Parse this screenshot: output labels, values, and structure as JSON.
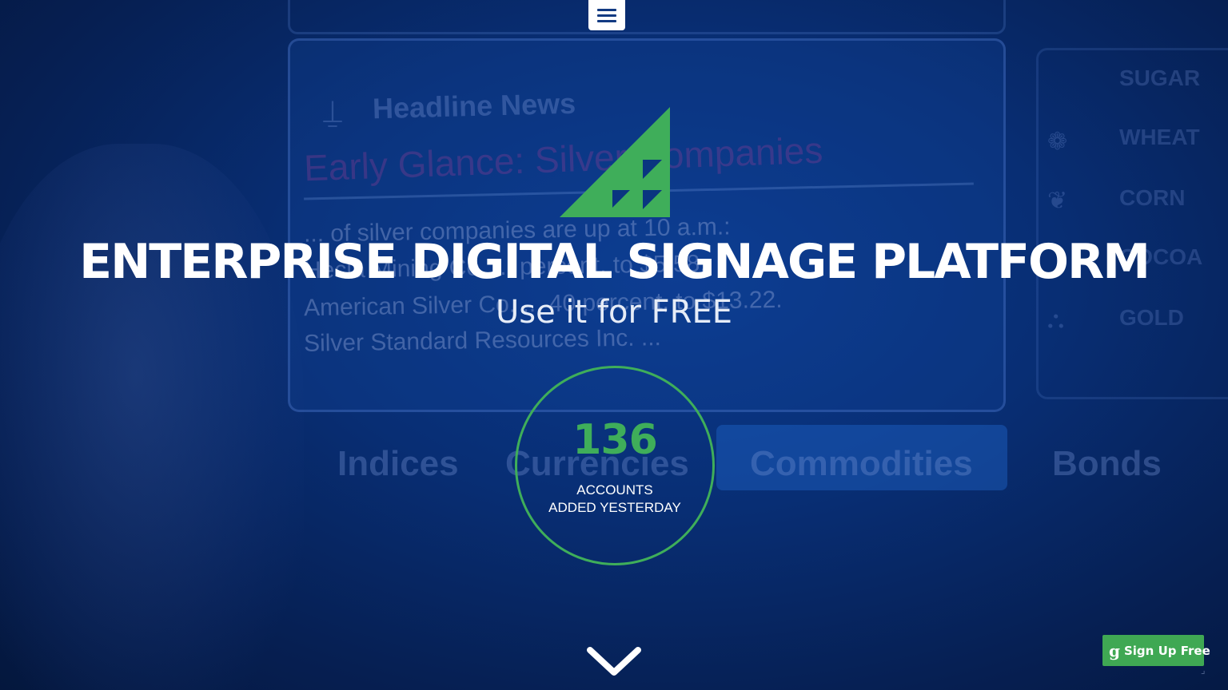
{
  "page": {
    "headline": "ENTERPRISE DIGITAL SIGNAGE PLATFORM",
    "subheadline": "Use it for FREE"
  },
  "nav": {
    "menu_icon": "hamburger-menu-icon"
  },
  "logo": {
    "icon": "triangle-logo-icon",
    "color": "#3fae5a"
  },
  "counter": {
    "value": "136",
    "label_line1": "ACCOUNTS",
    "label_line2": "ADDED YESTERDAY",
    "accent_color": "#3fae5a"
  },
  "scroll": {
    "icon": "chevron-down-icon"
  },
  "signup": {
    "icon": "google-g-icon",
    "icon_glyph": "g",
    "label": "Sign Up Free",
    "color": "#3fa853"
  },
  "background": {
    "headline_news": "Headline News",
    "early_glance": "Early Glance: Silver Companies",
    "story_lines": [
      "... of silver companies are up at 10 a.m.:",
      "Hecla Mining Co. ... percent, to $5.58.",
      "American Silver Co. ... 40 percent, to $13.22.",
      "Silver Standard Resources Inc. ..."
    ],
    "commodities": [
      "SUGAR",
      "WHEAT",
      "CORN",
      "COCOA",
      "GOLD"
    ],
    "tabs": [
      "Indices",
      "Currencies",
      "Commodities",
      "Bonds"
    ]
  },
  "colors": {
    "background": "#082e74",
    "accent": "#3fae5a",
    "text": "#ffffff"
  }
}
